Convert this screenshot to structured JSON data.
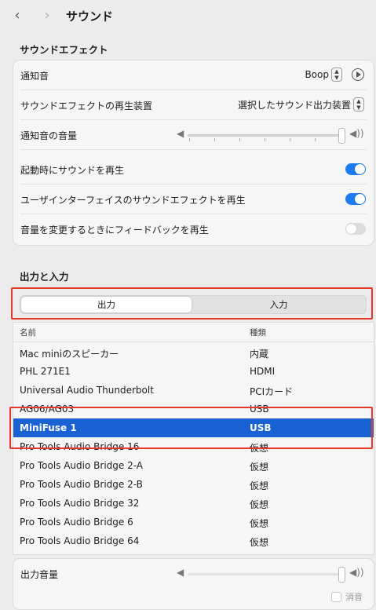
{
  "window": {
    "title": "サウンド",
    "back_icon": "chevron-left-icon",
    "forward_icon": "chevron-right-icon"
  },
  "sound_effects": {
    "section_title": "サウンドエフェクト",
    "alert_sound": {
      "label": "通知音",
      "value": "Boop"
    },
    "output_device": {
      "label": "サウンドエフェクトの再生装置",
      "value": "選択したサウンド出力装置"
    },
    "alert_volume": {
      "label": "通知音の音量",
      "level": 1.0
    },
    "startup_sound": {
      "label": "起動時にサウンドを再生",
      "on": true
    },
    "ui_effects": {
      "label": "ユーザインターフェイスのサウンドエフェクトを再生",
      "on": true
    },
    "volume_feedback": {
      "label": "音量を変更するときにフィードバックを再生",
      "on": false
    }
  },
  "io": {
    "section_title": "出力と入力",
    "tabs": [
      {
        "label": "出力",
        "selected": true
      },
      {
        "label": "入力",
        "selected": false
      }
    ],
    "columns": {
      "name": "名前",
      "type": "種類"
    },
    "devices": [
      {
        "name": "Mac miniのスピーカー",
        "type": "内蔵"
      },
      {
        "name": "PHL 271E1",
        "type": "HDMI"
      },
      {
        "name": "Universal Audio Thunderbolt",
        "type": "PCIカード"
      },
      {
        "name": "AG06/AG03",
        "type": "USB"
      },
      {
        "name": "MiniFuse 1",
        "type": "USB",
        "selected": true
      },
      {
        "name": "Pro Tools Audio Bridge 16",
        "type": "仮想"
      },
      {
        "name": "Pro Tools Audio Bridge 2-A",
        "type": "仮想"
      },
      {
        "name": "Pro Tools Audio Bridge 2-B",
        "type": "仮想"
      },
      {
        "name": "Pro Tools Audio Bridge 32",
        "type": "仮想"
      },
      {
        "name": "Pro Tools Audio Bridge 6",
        "type": "仮想"
      },
      {
        "name": "Pro Tools Audio Bridge 64",
        "type": "仮想"
      }
    ]
  },
  "output_volume": {
    "label": "出力音量",
    "level": 1.0,
    "mute_label": "消音",
    "muted": false
  },
  "colors": {
    "accent": "#1b7bef",
    "selection": "#1a62d4",
    "highlight_box": "#e8382c"
  }
}
